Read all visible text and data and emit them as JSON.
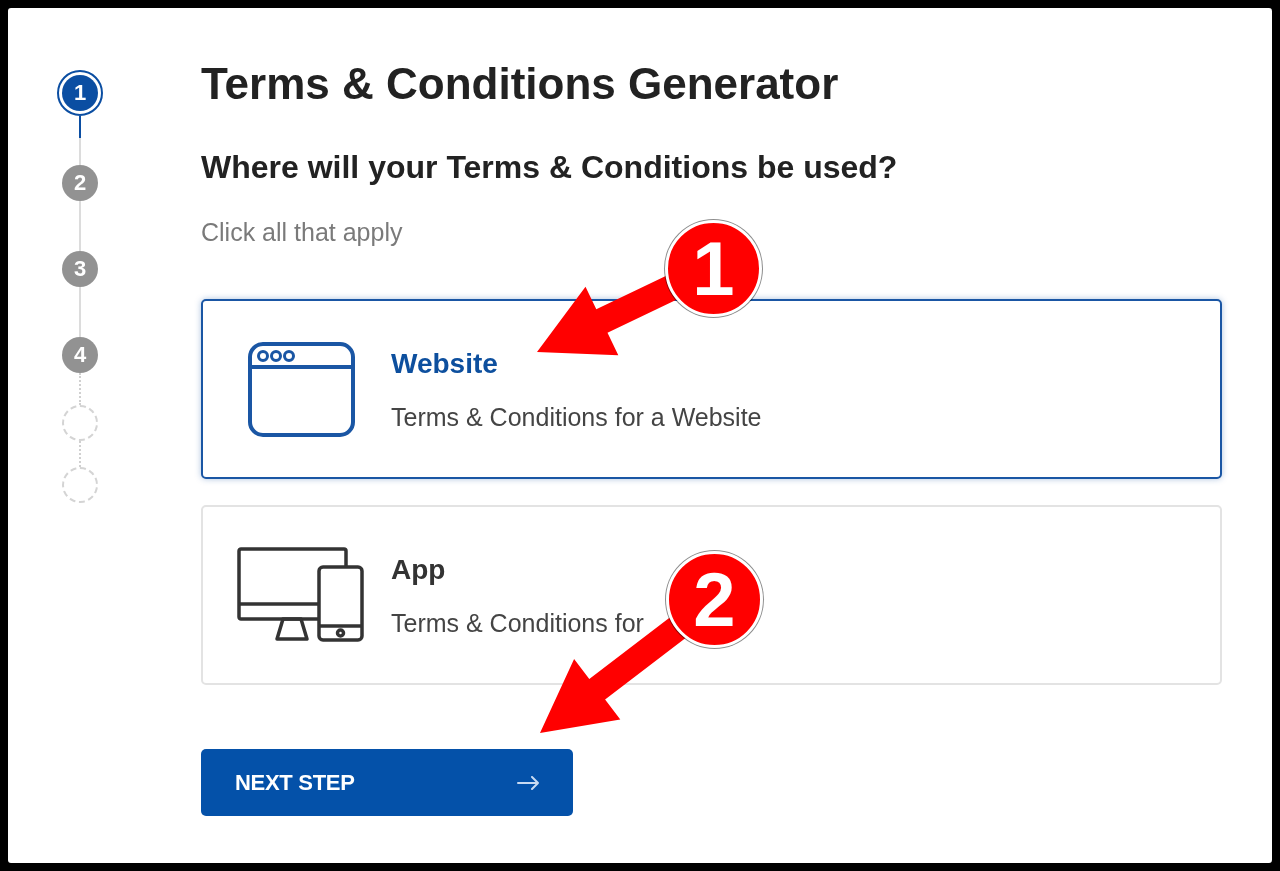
{
  "stepper": {
    "steps": [
      {
        "kind": "numbered",
        "label": "1",
        "selected": true
      },
      {
        "kind": "numbered",
        "label": "2",
        "selected": false
      },
      {
        "kind": "numbered",
        "label": "3",
        "selected": false
      },
      {
        "kind": "numbered",
        "label": "4",
        "selected": false
      },
      {
        "kind": "empty",
        "selected": false
      },
      {
        "kind": "empty",
        "selected": false
      }
    ]
  },
  "title": "Terms & Conditions Generator",
  "question": "Where will your Terms & Conditions be used?",
  "hint": "Click all that apply",
  "options": [
    {
      "kind": "website",
      "title": "Website",
      "description": "Terms & Conditions for a Website",
      "selected": true
    },
    {
      "kind": "app",
      "title": "App",
      "description": "Terms & Conditions for",
      "selected": false
    }
  ],
  "next_button": {
    "label": "NEXT STEP"
  },
  "annotations": [
    {
      "label": "1"
    },
    {
      "label": "2"
    }
  ]
}
